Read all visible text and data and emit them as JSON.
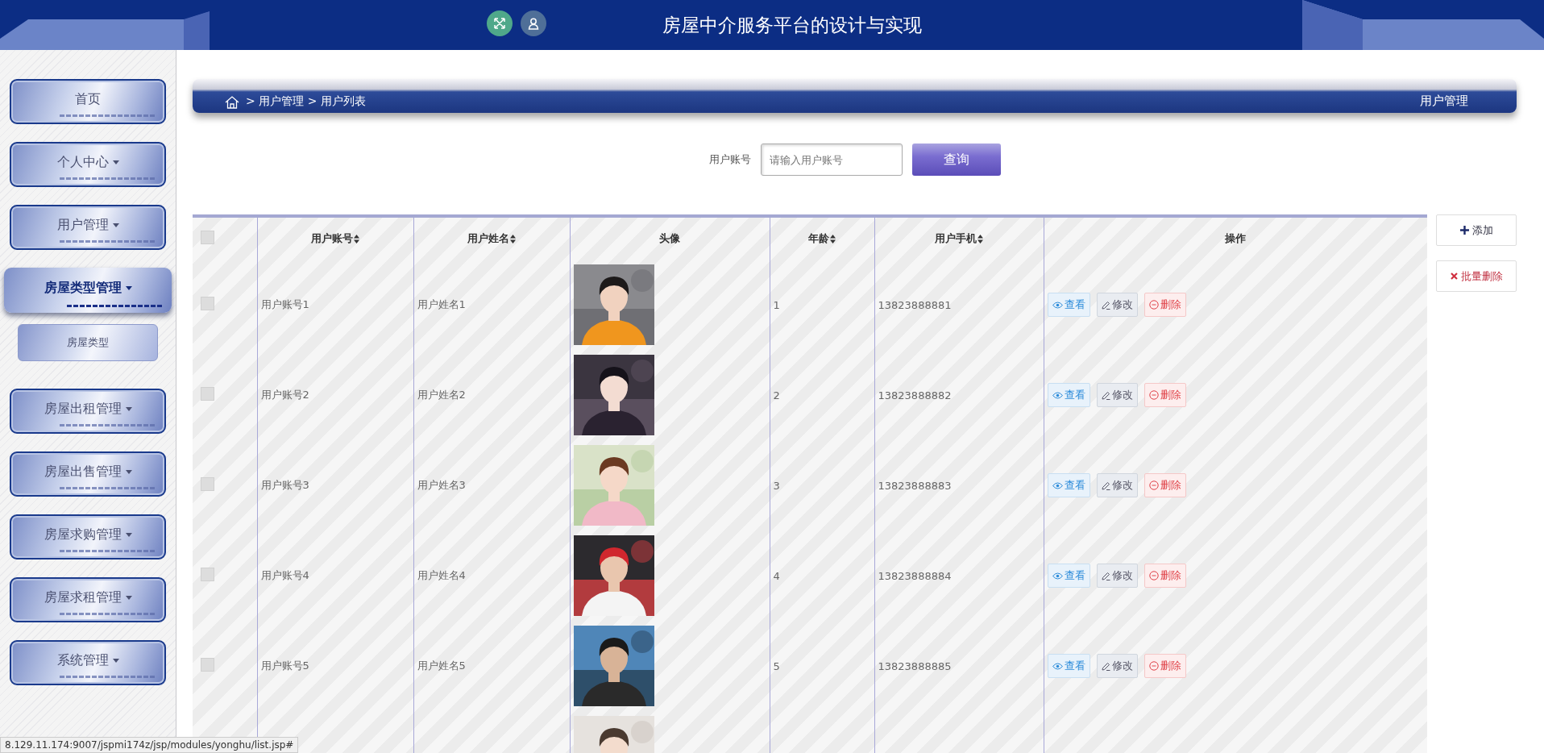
{
  "header": {
    "title": "房屋中介服务平台的设计与实现"
  },
  "sidebar": {
    "items": [
      {
        "label": "首页",
        "dropdown": false,
        "selected": false
      },
      {
        "label": "个人中心",
        "dropdown": true,
        "selected": false
      },
      {
        "label": "用户管理",
        "dropdown": true,
        "selected": false
      },
      {
        "label": "房屋类型管理",
        "dropdown": true,
        "selected": true,
        "children": [
          {
            "label": "房屋类型"
          }
        ]
      },
      {
        "label": "房屋出租管理",
        "dropdown": true,
        "selected": false
      },
      {
        "label": "房屋出售管理",
        "dropdown": true,
        "selected": false
      },
      {
        "label": "房屋求购管理",
        "dropdown": true,
        "selected": false
      },
      {
        "label": "房屋求租管理",
        "dropdown": true,
        "selected": false
      },
      {
        "label": "系统管理",
        "dropdown": true,
        "selected": false
      }
    ]
  },
  "breadcrumb": {
    "trail": "> 用户管理 > 用户列表",
    "title": "用户管理"
  },
  "search": {
    "label": "用户账号",
    "placeholder": "请输入用户账号",
    "button": "查询"
  },
  "side_actions": [
    {
      "kind": "add",
      "label": "添加"
    },
    {
      "kind": "batch_delete",
      "label": "批量删除"
    }
  ],
  "table": {
    "columns": [
      {
        "kind": "checkbox",
        "checked": false
      },
      {
        "label": "用户账号",
        "sortable": true
      },
      {
        "label": "用户姓名",
        "sortable": true
      },
      {
        "label": "头像",
        "sortable": false
      },
      {
        "label": "年龄",
        "sortable": true
      },
      {
        "label": "用户手机",
        "sortable": true
      },
      {
        "label": "操作",
        "sortable": false
      }
    ],
    "rows": [
      {
        "checked": false,
        "account": "用户账号1",
        "name": "用户姓名1",
        "avatar": {
          "kind": "picture"
        },
        "age": "1",
        "phone": "13823888881",
        "actions": [
          {
            "kind": "view",
            "label": "查看"
          },
          {
            "kind": "edit",
            "label": "修改"
          },
          {
            "kind": "delete",
            "label": "删除"
          }
        ]
      },
      {
        "checked": false,
        "account": "用户账号2",
        "name": "用户姓名2",
        "avatar": {
          "kind": "picture"
        },
        "age": "2",
        "phone": "13823888882",
        "actions": [
          {
            "kind": "view",
            "label": "查看"
          },
          {
            "kind": "edit",
            "label": "修改"
          },
          {
            "kind": "delete",
            "label": "删除"
          }
        ]
      },
      {
        "checked": false,
        "account": "用户账号3",
        "name": "用户姓名3",
        "avatar": {
          "kind": "picture"
        },
        "age": "3",
        "phone": "13823888883",
        "actions": [
          {
            "kind": "view",
            "label": "查看"
          },
          {
            "kind": "edit",
            "label": "修改"
          },
          {
            "kind": "delete",
            "label": "删除"
          }
        ]
      },
      {
        "checked": false,
        "account": "用户账号4",
        "name": "用户姓名4",
        "avatar": {
          "kind": "picture"
        },
        "age": "4",
        "phone": "13823888884",
        "actions": [
          {
            "kind": "view",
            "label": "查看"
          },
          {
            "kind": "edit",
            "label": "修改"
          },
          {
            "kind": "delete",
            "label": "删除"
          }
        ]
      },
      {
        "checked": false,
        "account": "用户账号5",
        "name": "用户姓名5",
        "avatar": {
          "kind": "picture"
        },
        "age": "5",
        "phone": "13823888885",
        "actions": [
          {
            "kind": "view",
            "label": "查看"
          },
          {
            "kind": "edit",
            "label": "修改"
          },
          {
            "kind": "delete",
            "label": "删除"
          }
        ]
      },
      {
        "avatar": {
          "kind": "picture"
        }
      }
    ]
  },
  "status_url": "8.129.11.174:9007/jspmi174z/jsp/modules/yonghu/list.jsp#"
}
